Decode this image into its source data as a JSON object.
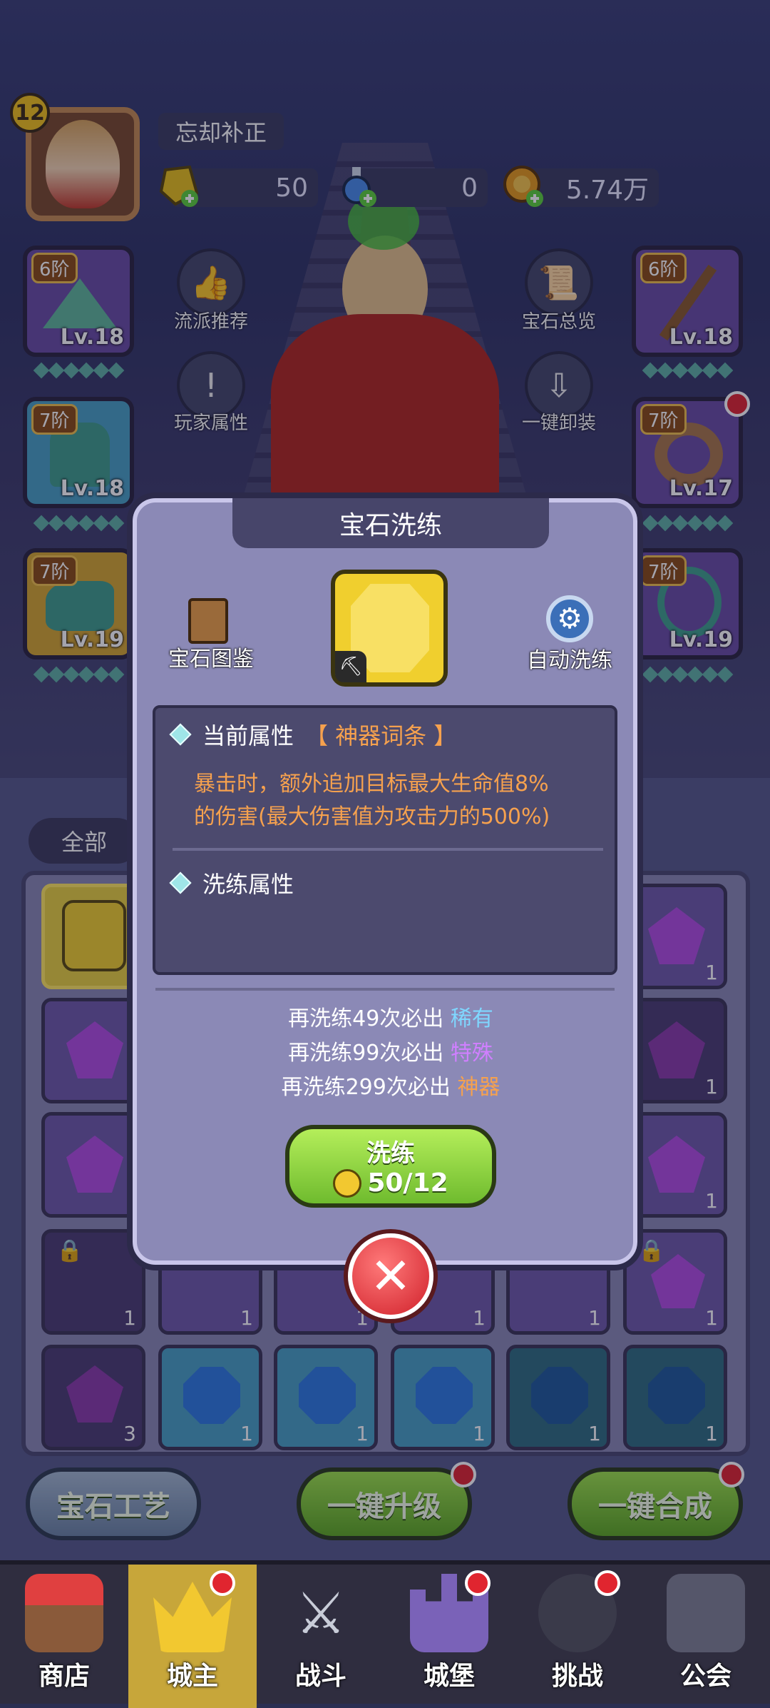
{
  "player": {
    "level": "12",
    "name": "忘却补正"
  },
  "resources": [
    {
      "icon": "gold-gem-icon",
      "value": "50"
    },
    {
      "icon": "potion-icon",
      "value": "0"
    },
    {
      "icon": "coin-icon",
      "value": "5.74万"
    }
  ],
  "equipment_left": [
    {
      "tier": "6阶",
      "level": "Lv.18",
      "icon": "wizard-hat-icon"
    },
    {
      "tier": "7阶",
      "level": "Lv.18",
      "icon": "robe-icon"
    },
    {
      "tier": "7阶",
      "level": "Lv.19",
      "icon": "boots-icon"
    }
  ],
  "equipment_right": [
    {
      "tier": "6阶",
      "level": "Lv.18",
      "icon": "staff-icon"
    },
    {
      "tier": "7阶",
      "level": "Lv.17",
      "icon": "ring-icon"
    },
    {
      "tier": "7阶",
      "level": "Lv.19",
      "icon": "necklace-icon"
    }
  ],
  "menu": {
    "build_recommend": "流派推荐",
    "player_attributes": "玩家属性",
    "gem_overview": "宝石总览",
    "unequip_all": "一键卸装"
  },
  "inventory": {
    "tab_all": "全部",
    "counts_right": [
      "1",
      "1",
      "1",
      "1",
      "1"
    ],
    "bottom_counts": [
      "3",
      "1",
      "1",
      "1",
      "1",
      "1"
    ],
    "row4_counts": [
      "1",
      "1",
      "1",
      "1",
      "1",
      "1"
    ]
  },
  "actions": {
    "gem_craft": "宝石工艺",
    "upgrade_all": "一键升级",
    "merge_all": "一键合成"
  },
  "modal": {
    "title": "宝石洗练",
    "gem_codex": "宝石图鉴",
    "auto_refine": "自动洗练",
    "current_attr_label": "当前属性",
    "current_attr_tag": "【 神器词条 】",
    "current_attr_desc_1": "暴击时，额外追加目标最大生命值8%",
    "current_attr_desc_2": "的伤害(最大伤害值为攻击力的500%)",
    "refine_attr_label": "洗练属性",
    "hint1_prefix": "再洗练49次必出",
    "hint1_rarity": "稀有",
    "hint2_prefix": "再洗练99次必出",
    "hint2_rarity": "特殊",
    "hint3_prefix": "再洗练299次必出",
    "hint3_rarity": "神器",
    "refine_button": "洗练",
    "refine_cost": "50/12"
  },
  "nav": [
    {
      "label": "商店",
      "icon": "shop-icon"
    },
    {
      "label": "城主",
      "icon": "crown-icon"
    },
    {
      "label": "战斗",
      "icon": "swords-icon"
    },
    {
      "label": "城堡",
      "icon": "castle-icon"
    },
    {
      "label": "挑战",
      "icon": "demon-icon"
    },
    {
      "label": "公会",
      "icon": "guild-icon"
    }
  ]
}
